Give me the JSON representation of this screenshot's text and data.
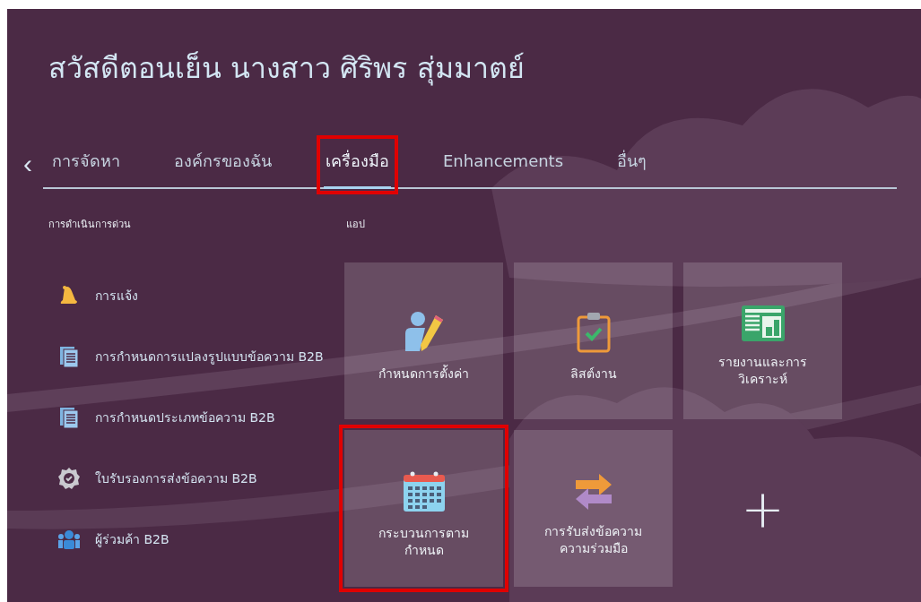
{
  "greeting": "สวัสดีตอนเย็น นางสาว ศิริพร สุ่มมาตย์",
  "nav": {
    "back": "‹"
  },
  "tabs": [
    {
      "label": "การจัดหา",
      "selected": false,
      "highlighted": false
    },
    {
      "label": "องค์กรของฉัน",
      "selected": false,
      "highlighted": false
    },
    {
      "label": "เครื่องมือ",
      "selected": true,
      "highlighted": true
    },
    {
      "label": "Enhancements",
      "selected": false,
      "highlighted": false
    },
    {
      "label": "อื่นๆ",
      "selected": false,
      "highlighted": false
    }
  ],
  "quick_actions": {
    "heading": "การดำเนินการด่วน",
    "items": [
      {
        "kind": "bell",
        "label": "การแจ้ง"
      },
      {
        "kind": "document",
        "label": "การกำหนดการแปลงรูปแบบข้อความ B2B"
      },
      {
        "kind": "document",
        "label": "การกำหนดประเภทข้อความ B2B"
      },
      {
        "kind": "certificate",
        "label": "ใบรับรองการส่งข้อความ B2B"
      },
      {
        "kind": "people",
        "label": "ผู้ร่วมค้า B2B"
      }
    ]
  },
  "apps": {
    "heading": "แอป",
    "tiles": [
      {
        "kind": "setup",
        "label": "กำหนดการตั้งค่า",
        "highlighted": false
      },
      {
        "kind": "tasks",
        "label": "ลิสต์งาน",
        "highlighted": false
      },
      {
        "kind": "report",
        "label": "รายงานและการ\nวิเคราะห์",
        "highlighted": false
      },
      {
        "kind": "calendar",
        "label": "กระบวนการตาม\nกำหนด",
        "highlighted": true
      },
      {
        "kind": "exchange",
        "label": "การรับส่งข้อความ\nความร่วมมือ",
        "highlighted": false
      },
      {
        "kind": "add",
        "label": "+",
        "highlighted": false
      }
    ]
  }
}
